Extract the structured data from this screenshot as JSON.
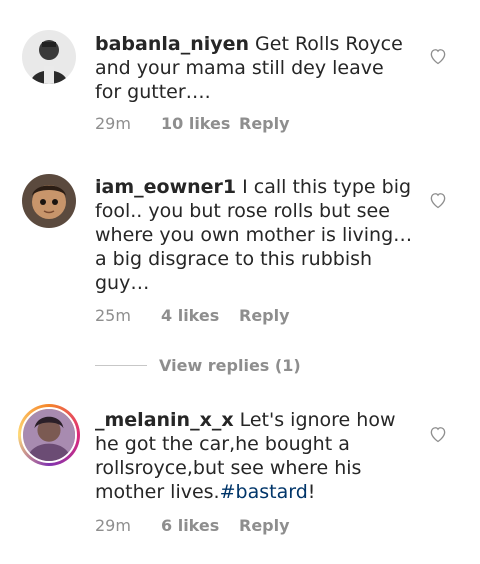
{
  "comments": [
    {
      "username": "babanla_niyen",
      "text": "Get Rolls Royce and your mama still dey leave for gutter….",
      "time": "29m",
      "likes": "10 likes",
      "reply": "Reply"
    },
    {
      "username": "iam_eowner1",
      "text": "I call this type big fool.. you but rose rolls but see where you own mother is living… a big disgrace to this rubbish guy…",
      "time": "25m",
      "likes": "4 likes",
      "reply": "Reply"
    },
    {
      "username": "_melanin_x_x",
      "text": "Let's ignore how he got the car,he bought a rollsroyce,but see where his mother lives.",
      "hashtag": "#bastard",
      "text_end": "!",
      "time": "29m",
      "likes": "6 likes",
      "reply": "Reply"
    }
  ],
  "view_replies": "View replies (1)",
  "colors": {
    "text": "#262626",
    "meta": "#8e8e8e",
    "hashtag": "#003569",
    "divider": "#c7c7c7"
  },
  "icons": {
    "like": "heart-outline-icon"
  }
}
